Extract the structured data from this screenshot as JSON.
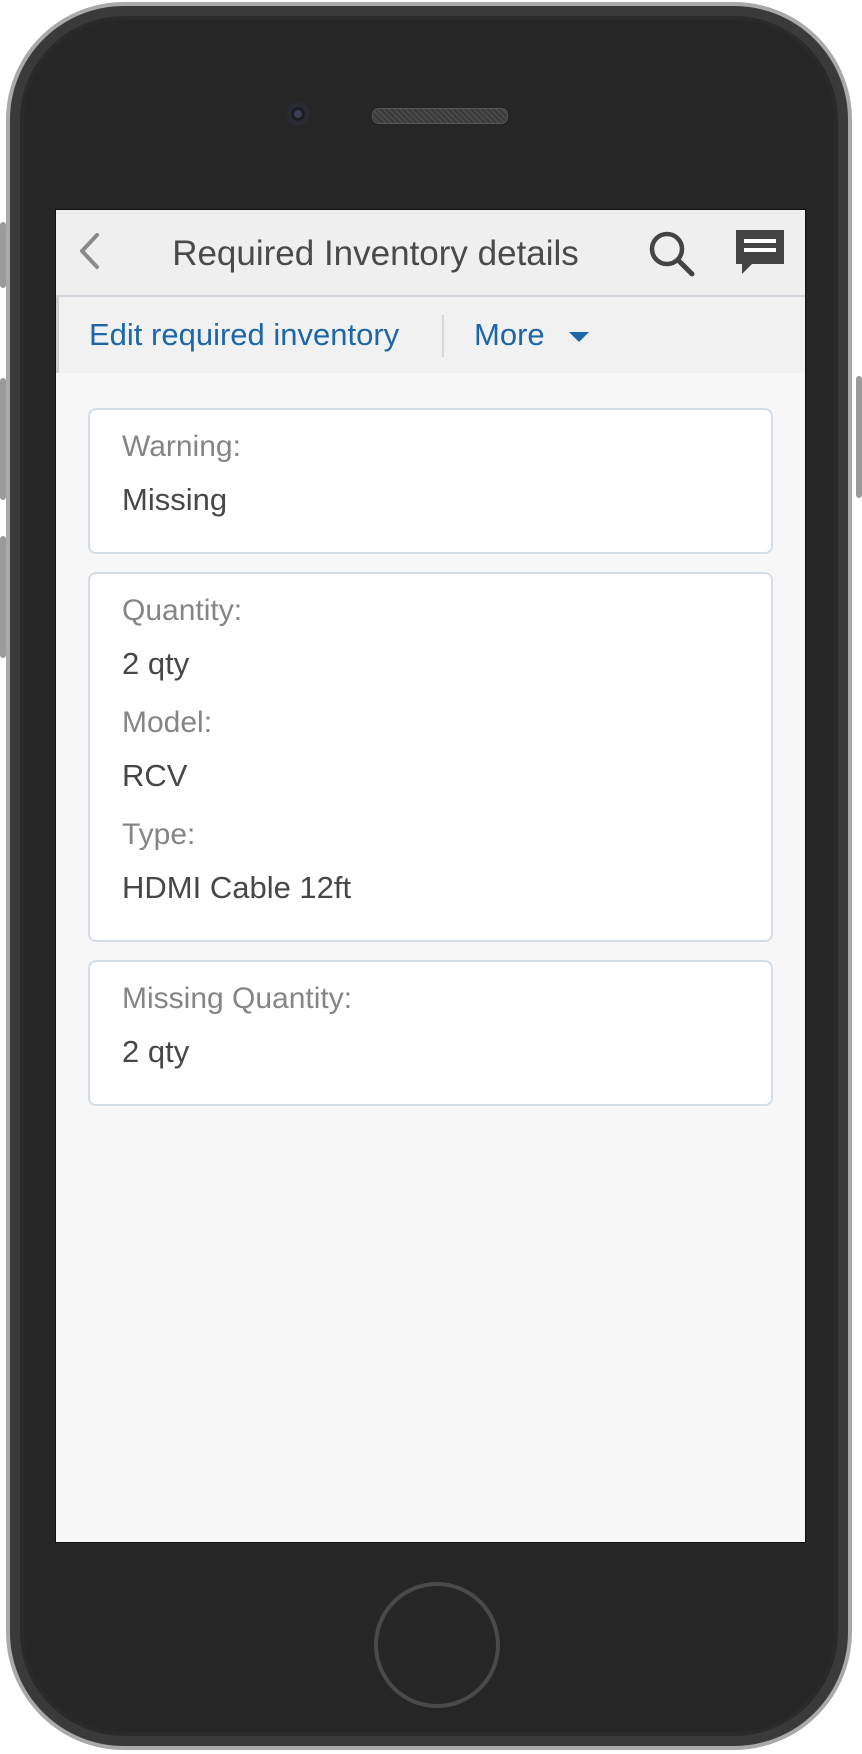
{
  "header": {
    "title": "Required Inventory details",
    "back_icon": "chevron-left-icon",
    "search_icon": "search-icon",
    "chat_icon": "chat-icon"
  },
  "actions": {
    "edit_label": "Edit required inventory",
    "more_label": "More",
    "more_icon": "caret-down-icon"
  },
  "cards": {
    "warning": {
      "label": "Warning:",
      "value": "Missing"
    },
    "details": {
      "quantity_label": "Quantity:",
      "quantity_value": "2 qty",
      "model_label": "Model:",
      "model_value": "RCV",
      "type_label": "Type:",
      "type_value": "HDMI Cable 12ft"
    },
    "missing": {
      "label": "Missing Quantity:",
      "value": "2 qty"
    }
  },
  "colors": {
    "accent": "#1d66a8",
    "label": "#858585",
    "value": "#474747",
    "card_border": "#d4dde6"
  }
}
